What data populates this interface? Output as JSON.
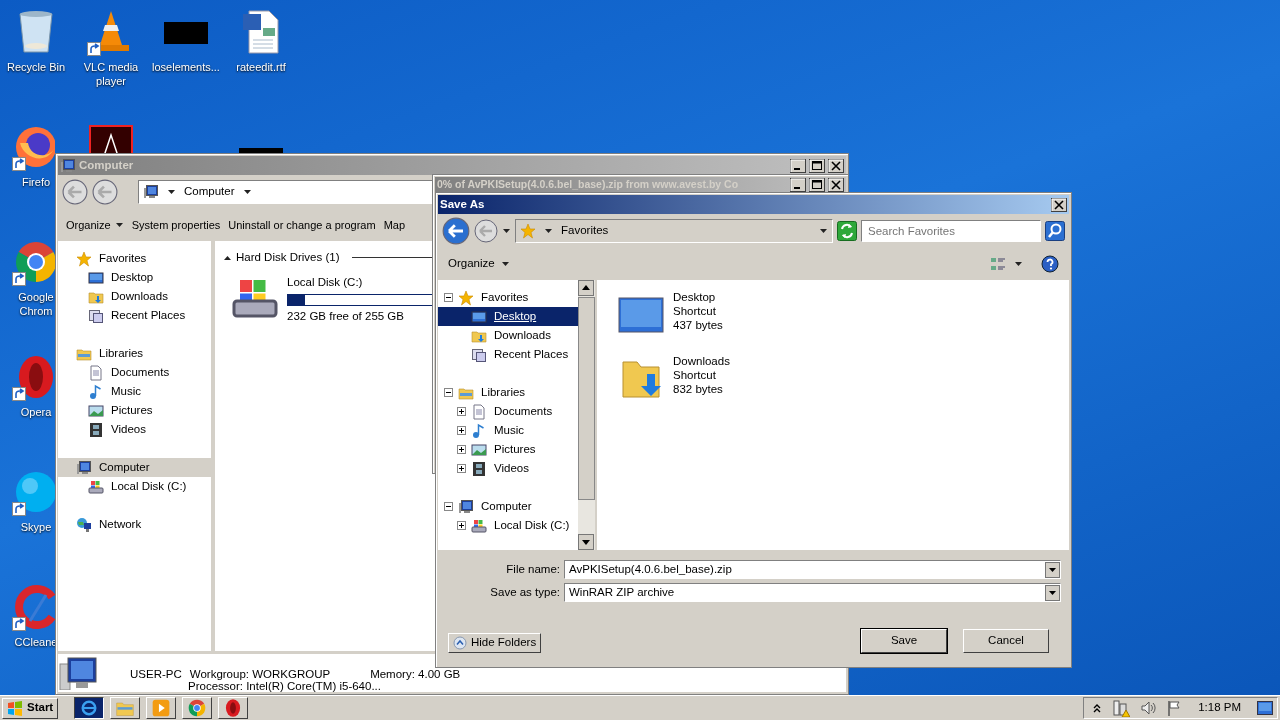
{
  "desktop_icons": [
    {
      "kind": "recycle-bin",
      "label": "Recycle Bin",
      "shortcut": false
    },
    {
      "kind": "vlc",
      "label": "VLC media player",
      "shortcut": true
    },
    {
      "kind": "black-thumbnail",
      "label": "loselements...",
      "shortcut": false
    },
    {
      "kind": "word-document",
      "label": "rateedit.rtf",
      "shortcut": false
    },
    {
      "kind": "firefox",
      "label": "Firefo",
      "shortcut": true
    },
    {
      "kind": "pdf-reader"
    },
    {
      "kind": "black-thumbnail"
    },
    {
      "kind": "chrome",
      "label": "Google Chrom",
      "shortcut": true
    },
    {
      "kind": "opera",
      "label": "Opera",
      "shortcut": true
    },
    {
      "kind": "skype",
      "label": "Skype",
      "shortcut": true
    },
    {
      "kind": "ccleaner",
      "label": "CCleane",
      "shortcut": true
    }
  ],
  "explorer": {
    "title": "Computer",
    "address": "Computer",
    "toolbar": [
      {
        "label": "Organize",
        "dropdown": true
      },
      {
        "label": "System properties",
        "dropdown": false
      },
      {
        "label": "Uninstall or change a program",
        "dropdown": false
      },
      {
        "label": "Map",
        "dropdown": false
      }
    ],
    "nav": [
      {
        "kind": "favorites",
        "label": "Favorites",
        "selected": false,
        "children": [
          {
            "kind": "desktop",
            "label": "Desktop",
            "selected": false
          },
          {
            "kind": "downloads",
            "label": "Downloads",
            "selected": false
          },
          {
            "kind": "recent",
            "label": "Recent Places",
            "selected": false
          }
        ]
      },
      {
        "kind": "libraries",
        "label": "Libraries",
        "selected": false,
        "children": [
          {
            "kind": "documents",
            "label": "Documents",
            "selected": false
          },
          {
            "kind": "music",
            "label": "Music",
            "selected": false
          },
          {
            "kind": "pictures",
            "label": "Pictures",
            "selected": false
          },
          {
            "kind": "videos",
            "label": "Videos",
            "selected": false
          }
        ]
      },
      {
        "kind": "computer",
        "label": "Computer",
        "selected": true,
        "children": [
          {
            "kind": "disk",
            "label": "Local Disk (C:)",
            "selected": false
          }
        ]
      },
      {
        "kind": "network",
        "label": "Network",
        "selected": false
      }
    ],
    "group": "Hard Disk Drives (1)",
    "drive": {
      "name": "Local Disk (C:)",
      "level": 0.12,
      "free": "232 GB free of 255 GB"
    },
    "details": {
      "name": "USER-PC",
      "workgroup": "Workgroup: WORKGROUP",
      "memory": "Memory: 4.00 GB",
      "processor": "Processor: Intel(R) Core(TM) i5-640..."
    }
  },
  "download_window": {
    "title": "0% of AvPKISetup(4.0.6.bel_base).zip from www.avest.by Co"
  },
  "save_as": {
    "title": "Save As",
    "address": "Favorites",
    "search": {
      "placeholder": "Search Favorites"
    },
    "organize": "Organize",
    "tree": [
      {
        "kind": "favorites",
        "label": "Favorites",
        "expanded": true,
        "selected": false,
        "children": [
          {
            "kind": "desktop",
            "label": "Desktop",
            "selected": true
          },
          {
            "kind": "downloads",
            "label": "Downloads",
            "selected": false
          },
          {
            "kind": "recent",
            "label": "Recent Places",
            "selected": false
          }
        ]
      },
      {
        "kind": "libraries",
        "label": "Libraries",
        "expanded": true,
        "selected": false,
        "children": [
          {
            "kind": "documents",
            "label": "Documents",
            "expanded": false,
            "selected": false
          },
          {
            "kind": "music",
            "label": "Music",
            "expanded": false,
            "selected": false
          },
          {
            "kind": "pictures",
            "label": "Pictures",
            "expanded": false,
            "selected": false
          },
          {
            "kind": "videos",
            "label": "Videos",
            "expanded": false,
            "selected": false
          }
        ]
      },
      {
        "kind": "computer",
        "label": "Computer",
        "expanded": true,
        "selected": false,
        "children": [
          {
            "kind": "disk",
            "label": "Local Disk (C:)",
            "expanded": false,
            "selected": false
          }
        ]
      }
    ],
    "files": [
      {
        "kind": "desktop",
        "name": "Desktop",
        "type": "Shortcut",
        "size": "437 bytes"
      },
      {
        "kind": "downloads",
        "name": "Downloads",
        "type": "Shortcut",
        "size": "832 bytes"
      }
    ],
    "fields": [
      {
        "label": "File name:",
        "value": "AvPKISetup(4.0.6.bel_base).zip"
      },
      {
        "label": "Save as type:",
        "value": "WinRAR ZIP archive"
      }
    ],
    "hide_folders": "Hide Folders",
    "buttons": [
      {
        "label": "Save",
        "default": true
      },
      {
        "label": "Cancel",
        "default": false
      }
    ]
  },
  "taskbar": {
    "start": "Start",
    "items": [
      {
        "kind": "ie",
        "selected": true
      },
      {
        "kind": "explorer",
        "selected": false
      },
      {
        "kind": "media",
        "selected": false
      },
      {
        "kind": "chrome",
        "selected": false
      },
      {
        "kind": "opera",
        "selected": false
      }
    ],
    "clock": "1:18 PM"
  }
}
